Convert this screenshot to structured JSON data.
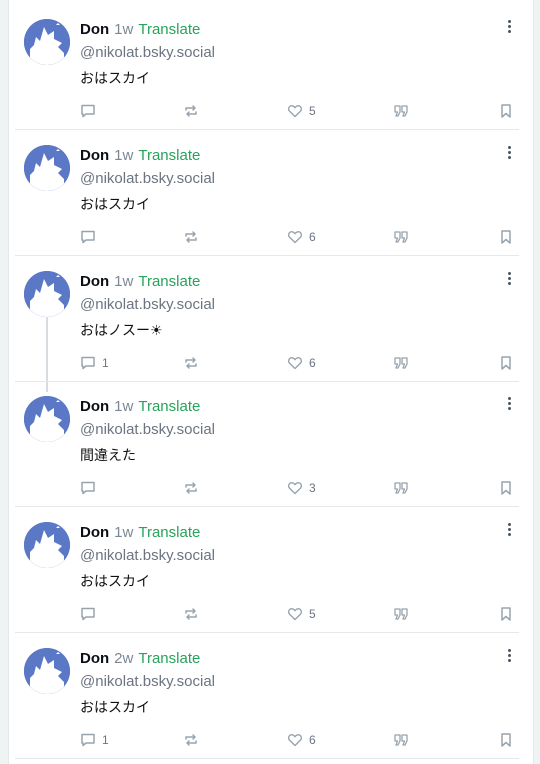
{
  "posts": [
    {
      "name": "Don",
      "time": "1w",
      "translate": "Translate",
      "handle": "@nikolat.bsky.social",
      "text": "おはスカイ",
      "reply_count": "",
      "like_count": "5"
    },
    {
      "name": "Don",
      "time": "1w",
      "translate": "Translate",
      "handle": "@nikolat.bsky.social",
      "text": "おはスカイ",
      "reply_count": "",
      "like_count": "6"
    },
    {
      "name": "Don",
      "time": "1w",
      "translate": "Translate",
      "handle": "@nikolat.bsky.social",
      "text": "おはノスー☀",
      "reply_count": "1",
      "like_count": "6"
    },
    {
      "name": "Don",
      "time": "1w",
      "translate": "Translate",
      "handle": "@nikolat.bsky.social",
      "text": "間違えた",
      "reply_count": "",
      "like_count": "3"
    },
    {
      "name": "Don",
      "time": "1w",
      "translate": "Translate",
      "handle": "@nikolat.bsky.social",
      "text": "おはスカイ",
      "reply_count": "",
      "like_count": "5"
    },
    {
      "name": "Don",
      "time": "2w",
      "translate": "Translate",
      "handle": "@nikolat.bsky.social",
      "text": "おはスカイ",
      "reply_count": "1",
      "like_count": "6"
    }
  ],
  "icons": {
    "avatar": "shark-avatar",
    "more": "more-vertical-icon",
    "reply": "comment-icon",
    "repost": "repost-icon",
    "like": "heart-icon",
    "quote": "quote-icon",
    "bookmark": "bookmark-icon"
  },
  "colors": {
    "translate": "#27a35a",
    "avatar_bg": "#5a78c6",
    "action_icon": "#98a3ad"
  }
}
